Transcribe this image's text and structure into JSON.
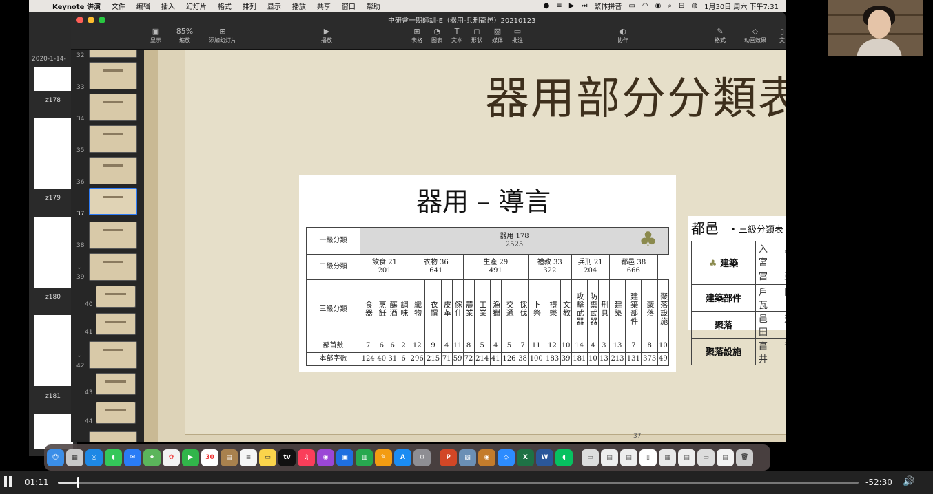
{
  "menubar": {
    "app": "Keynote 讲演",
    "items": [
      "文件",
      "编辑",
      "插入",
      "幻灯片",
      "格式",
      "排列",
      "显示",
      "播放",
      "共享",
      "窗口",
      "帮助"
    ],
    "input_method": "繁体拼音",
    "datetime": "1月30日 周六 下午7:31"
  },
  "background_window": {
    "date": "2020-1-14-",
    "labels": [
      "z178",
      "z179",
      "z180",
      "z181"
    ]
  },
  "keynote": {
    "title": "中研會一期師訓-E（器用-兵刑都邑）20210123",
    "toolbar": {
      "view": "显示",
      "zoom": "85%",
      "zoom_label": "缩放",
      "add_slide": "添加幻灯片",
      "play": "播放",
      "table": "表格",
      "chart": "图表",
      "text": "文本",
      "shape": "形状",
      "media": "媒体",
      "comment": "批注",
      "collaborate": "协作",
      "format": "格式",
      "animate": "动画效果",
      "document": "文"
    },
    "navigator": {
      "numbers": [
        "32",
        "33",
        "34",
        "35",
        "36",
        "37",
        "38",
        "39",
        "40",
        "41",
        "42",
        "43",
        "44"
      ],
      "selected": "37"
    }
  },
  "slide": {
    "title": "器用部分分類表",
    "page_number": "37",
    "image1": {
      "heading": "器用 – 導言",
      "row_labels": [
        "一級分類",
        "二級分類",
        "三級分類",
        "部首數",
        "本部字數"
      ],
      "level1": "器用 178",
      "level1_count": "2525",
      "level2": [
        {
          "name": "飲食 21",
          "count": "201",
          "span": 4
        },
        {
          "name": "衣物 36",
          "count": "641",
          "span": 4
        },
        {
          "name": "生產 29",
          "count": "491",
          "span": 5
        },
        {
          "name": "禮教 33",
          "count": "322",
          "span": 3
        },
        {
          "name": "兵刑 21",
          "count": "204",
          "span": 3
        },
        {
          "name": "都邑 38",
          "count": "666",
          "span": 3
        }
      ],
      "level3": [
        "食器",
        "烹飪",
        "釀酒",
        "調味",
        "織物",
        "衣帽",
        "皮革",
        "傢什",
        "農業",
        "工業",
        "漁獵",
        "交通",
        "採伐",
        "卜祭",
        "禮樂",
        "文教",
        "攻擊武器",
        "防禦武器",
        "刑具",
        "建築",
        "建築部件",
        "聚落",
        "聚落設施"
      ],
      "radical_counts": [
        "7",
        "6",
        "6",
        "2",
        "12",
        "9",
        "4",
        "11",
        "8",
        "5",
        "4",
        "5",
        "7",
        "11",
        "12",
        "10",
        "14",
        "4",
        "3",
        "13",
        "7",
        "8",
        "10"
      ],
      "char_counts": [
        "124",
        "40",
        "31",
        "6",
        "296",
        "215",
        "71",
        "59",
        "72",
        "214",
        "41",
        "126",
        "38",
        "100",
        "183",
        "39",
        "181",
        "10",
        "13",
        "213",
        "131",
        "373",
        "49"
      ]
    },
    "image2": {
      "title": "都邑",
      "subtitle": "三級分類表",
      "rows": [
        {
          "label": "建築",
          "chars": [
            "入 亼 宀 穴 宮",
            "富 亞"
          ]
        },
        {
          "label": "建築部件",
          "chars": [
            "戶 門 囧 朙 瓦"
          ]
        },
        {
          "label": "聚落",
          "chars": [
            "邑 䢔 行 彳 田"
          ]
        },
        {
          "label": "聚落設施",
          "chars": [
            "亯 嗇 倉 會 井"
          ]
        }
      ]
    }
  },
  "player": {
    "elapsed": "01:11",
    "remaining": "-52:30",
    "progress_fraction": 0.024
  }
}
